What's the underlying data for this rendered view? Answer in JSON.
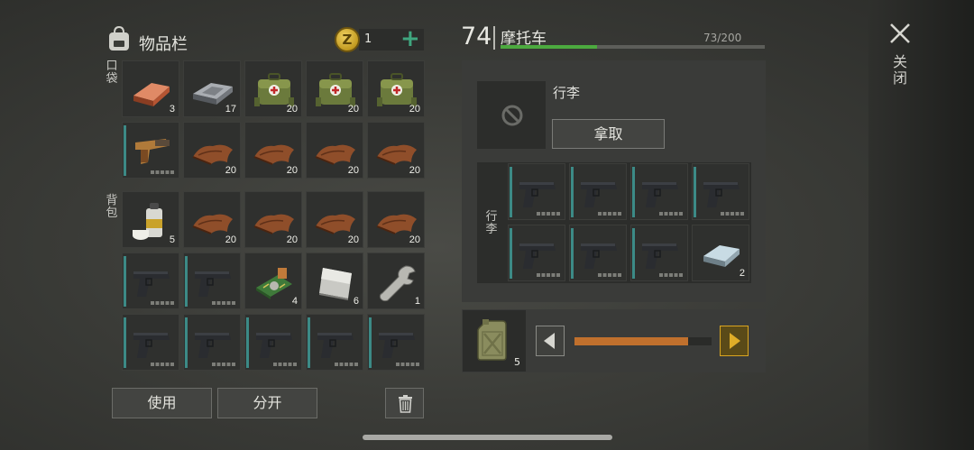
{
  "inventory": {
    "title": "物品栏",
    "coins": "1",
    "coin_symbol": "Z",
    "pocket_label": "口袋",
    "backpack_label": "背包",
    "use_button": "使用",
    "split_button": "分开"
  },
  "vehicle": {
    "level": "74",
    "name": "摩托车",
    "capacity": "73/200",
    "capacity_fraction": 0.365,
    "trunk_title": "行李",
    "take_button": "拿取",
    "trunk_side_label": "行李",
    "fuel_count": "5",
    "fuel_slider_fraction": 0.83
  },
  "close_label": "关闭",
  "colors": {
    "accent_green": "#4caa3f",
    "plus_green": "#3fa67f",
    "slider_orange": "#c0702d",
    "arrow_yellow": "#d9a520",
    "durability_bar": "#3c8a86"
  },
  "slots": {
    "pocket_row1": [
      {
        "icon": "copper-ingot-icon",
        "count": "3"
      },
      {
        "icon": "metal-bar-icon",
        "count": "17"
      },
      {
        "icon": "medical-bag-icon",
        "count": "20"
      },
      {
        "icon": "medical-bag-icon",
        "count": "20"
      },
      {
        "icon": "medical-bag-icon",
        "count": "20"
      }
    ],
    "pocket_row2": [
      {
        "icon": "flare-gun-icon",
        "count": ""
      },
      {
        "icon": "leather-icon",
        "count": "20"
      },
      {
        "icon": "leather-icon",
        "count": "20"
      },
      {
        "icon": "leather-icon",
        "count": "20"
      },
      {
        "icon": "leather-icon",
        "count": "20"
      }
    ],
    "backpack_row1": [
      {
        "icon": "spray-can-icon",
        "count": "5"
      },
      {
        "icon": "leather-icon",
        "count": "20"
      },
      {
        "icon": "leather-icon",
        "count": "20"
      },
      {
        "icon": "leather-icon",
        "count": "20"
      },
      {
        "icon": "leather-icon",
        "count": "20"
      }
    ],
    "backpack_row2": [
      {
        "icon": "pistol-icon",
        "count": ""
      },
      {
        "icon": "pistol-icon",
        "count": ""
      },
      {
        "icon": "circuit-board-icon",
        "count": "4"
      },
      {
        "icon": "metal-sheet-icon",
        "count": "6"
      },
      {
        "icon": "wrench-icon",
        "count": "1"
      }
    ],
    "backpack_row3": [
      {
        "icon": "pistol-icon",
        "count": ""
      },
      {
        "icon": "pistol-icon",
        "count": ""
      },
      {
        "icon": "pistol-icon",
        "count": ""
      },
      {
        "icon": "pistol-icon",
        "count": ""
      },
      {
        "icon": "pistol-icon",
        "count": ""
      }
    ],
    "trunk_row1": [
      {
        "icon": "pistol-icon",
        "count": ""
      },
      {
        "icon": "pistol-icon",
        "count": ""
      },
      {
        "icon": "pistol-icon",
        "count": ""
      },
      {
        "icon": "pistol-icon",
        "count": ""
      }
    ],
    "trunk_row2": [
      {
        "icon": "pistol-icon",
        "count": ""
      },
      {
        "icon": "pistol-icon",
        "count": ""
      },
      {
        "icon": "pistol-icon",
        "count": ""
      },
      {
        "icon": "iron-ingot-icon",
        "count": "2"
      }
    ]
  }
}
